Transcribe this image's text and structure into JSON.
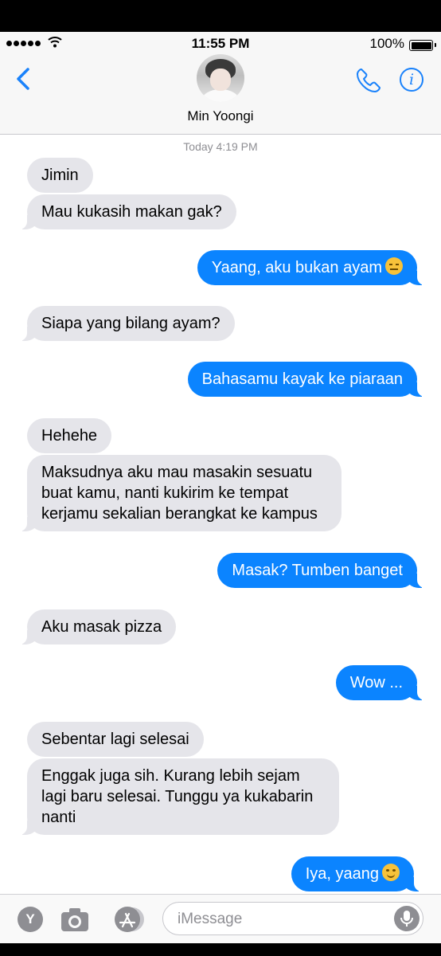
{
  "status_bar": {
    "time": "11:55 PM",
    "battery": "100%"
  },
  "header": {
    "contact_name": "Min Yoongi"
  },
  "thread": {
    "timestamp": "Today 4:19 PM",
    "messages": [
      {
        "from": "them",
        "text": "Jimin"
      },
      {
        "from": "them",
        "text": "Mau kukasih makan gak?"
      },
      {
        "from": "me",
        "text": "Yaang, aku bukan ayam",
        "emoji": "expressionless-face"
      },
      {
        "from": "them",
        "text": "Siapa yang bilang ayam?"
      },
      {
        "from": "me",
        "text": "Bahasamu kayak ke piaraan"
      },
      {
        "from": "them",
        "text": "Hehehe"
      },
      {
        "from": "them",
        "lines": [
          "Maksudnya aku mau masakin sesuatu",
          "buat kamu, nanti kukirim ke tempat",
          "kerjamu sekalian berangkat ke kampus"
        ]
      },
      {
        "from": "me",
        "text": "Masak? Tumben banget"
      },
      {
        "from": "them",
        "text": "Aku masak pizza"
      },
      {
        "from": "me",
        "text": "Wow ..."
      },
      {
        "from": "them",
        "text": "Sebentar lagi selesai"
      },
      {
        "from": "them",
        "lines": [
          "Enggak juga sih. Kurang lebih sejam",
          "lagi baru selesai. Tunggu ya kukabarin",
          "nanti"
        ]
      },
      {
        "from": "me",
        "text": "Iya, yaang",
        "emoji": "smiling-face"
      }
    ]
  },
  "input_bar": {
    "y_button_label": "Y",
    "placeholder": "iMessage"
  },
  "colors": {
    "accent": "#1a82fb",
    "outgoing_bubble": "#0b84ff",
    "incoming_bubble": "#e5e5ea"
  }
}
